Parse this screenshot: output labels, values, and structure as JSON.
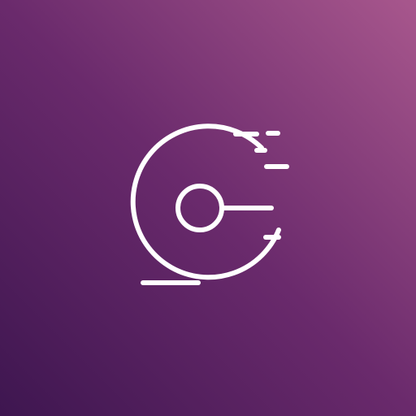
{
  "app_icon": {
    "icon": "disc-speed-icon",
    "background_gradient": [
      "#3e1650",
      "#6a2a6c",
      "#a8578d"
    ],
    "stroke_color": "#ffffff"
  }
}
